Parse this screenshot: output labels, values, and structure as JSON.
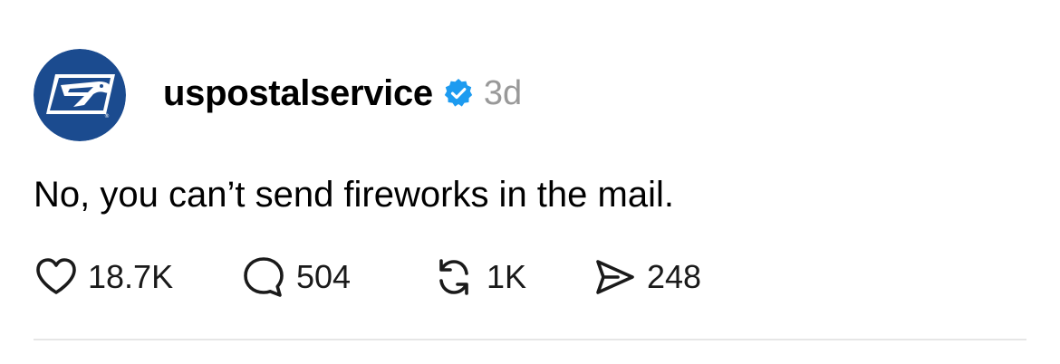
{
  "post": {
    "username": "uspostalservice",
    "verified_icon": "verified-badge-icon",
    "timestamp": "3d",
    "text": "No, you can’t send fireworks in the mail.",
    "avatar": {
      "icon": "usps-eagle-logo",
      "background_color": "#1b4b8f"
    }
  },
  "actions": {
    "like": {
      "icon": "heart-icon",
      "count": "18.7K"
    },
    "reply": {
      "icon": "comment-icon",
      "count": "504"
    },
    "repost": {
      "icon": "repost-icon",
      "count": "1K"
    },
    "share": {
      "icon": "send-icon",
      "count": "248"
    }
  },
  "colors": {
    "verified_badge": "#1d9bf0",
    "timestamp": "#999999",
    "divider": "#e6e6e6"
  }
}
